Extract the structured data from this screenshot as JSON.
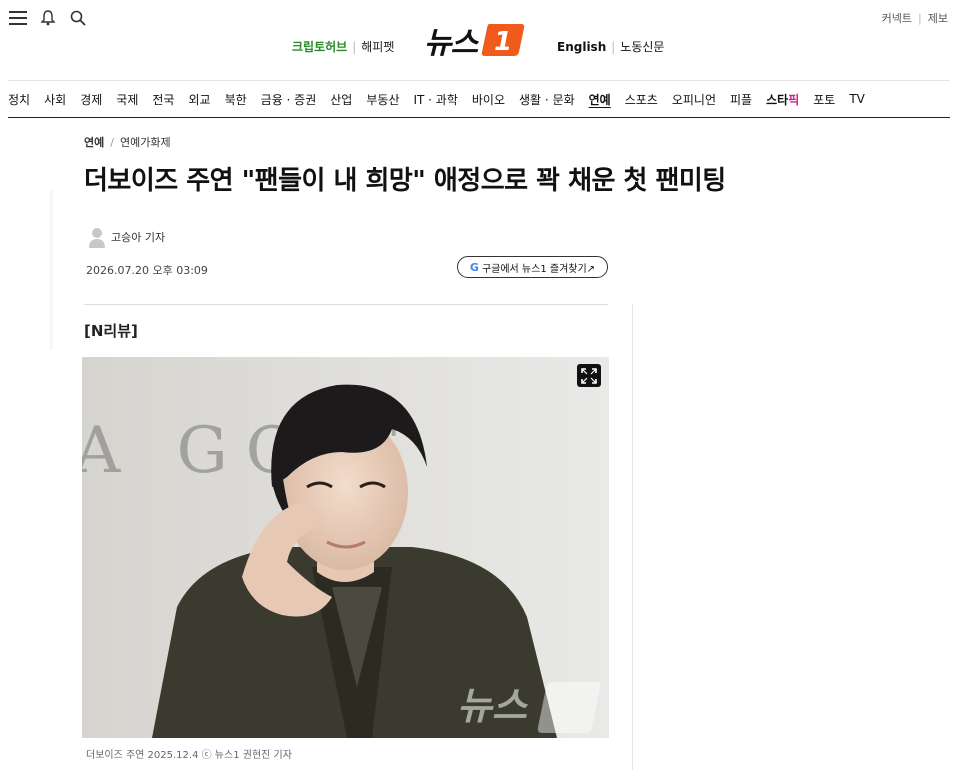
{
  "header": {
    "menu_icon": "hamburger-icon",
    "bell_icon": "bell-icon",
    "search_icon": "search-icon",
    "top_right": [
      "커넥트",
      "제보"
    ],
    "left_links": {
      "first": "크립토허브",
      "second": "해피펫"
    },
    "logo_text": "뉴스",
    "logo_badge": "1",
    "right_links": {
      "first": "English",
      "second": "노동신문"
    }
  },
  "nav": {
    "items": [
      "정치",
      "사회",
      "경제",
      "국제",
      "전국",
      "외교",
      "북한",
      "금융 · 증권",
      "산업",
      "부동산",
      "IT · 과학",
      "바이오",
      "생활 · 문화",
      "연예",
      "스포츠",
      "오피니언",
      "피플"
    ],
    "star": {
      "part1": "스타",
      "part2": "픽"
    },
    "tail": [
      "포토",
      "TV"
    ],
    "active": "연예"
  },
  "article": {
    "breadcrumb": {
      "section": "연예",
      "subsection": "연예가화제"
    },
    "title": "더보이즈 주연 \"팬들이 내 희망\" 애정으로 꽉 채운 첫 팬미팅",
    "author": "고승아 기자",
    "date": "2026.07.20 오후 03:09",
    "google_button": "구글에서 뉴스1 즐겨찾기↗",
    "google_letter": "G",
    "tag": "[N리뷰]",
    "photo_caption": "더보이즈 주연 2025.12.4 ⓒ 뉴스1 권현진 기자",
    "photo_backdrop_text": "A GO E",
    "watermark": "뉴스",
    "expand_icon": "expand-icon"
  },
  "colors": {
    "green": "#2a8a2a",
    "logo_orange": "#f05a1a",
    "star_pink": "#d21e8c"
  }
}
